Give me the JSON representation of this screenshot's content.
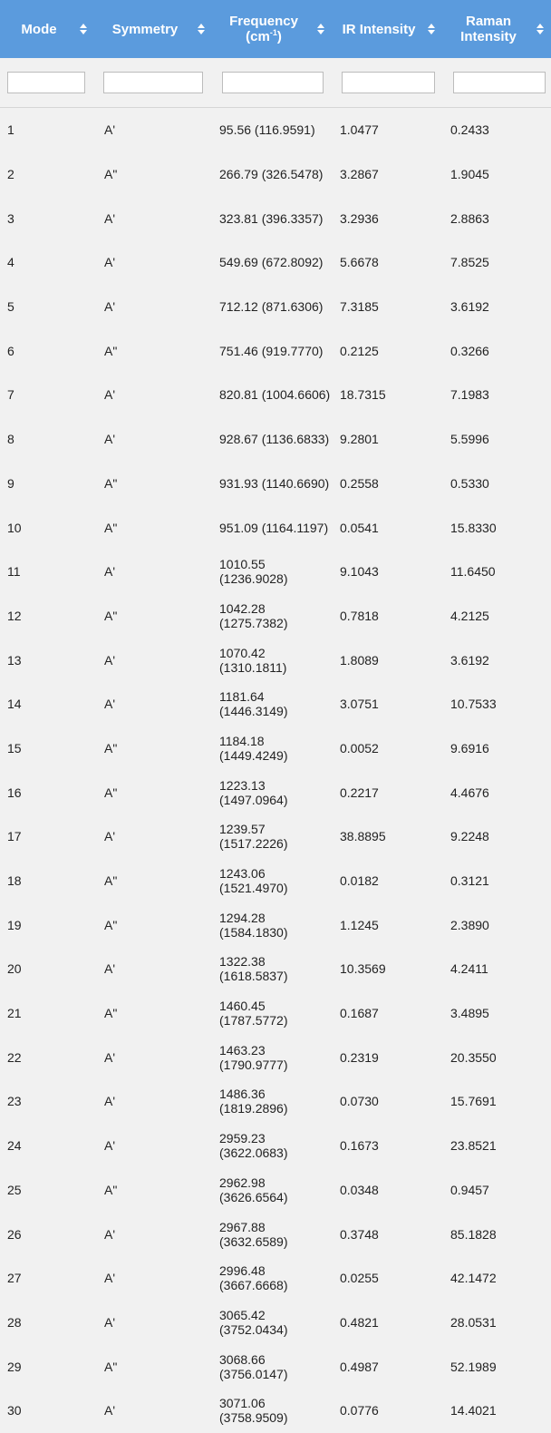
{
  "columns": [
    {
      "label": "Mode"
    },
    {
      "label": "Symmetry"
    },
    {
      "label": "Frequency (cm",
      "sup": "-1",
      "suffix": ")"
    },
    {
      "label": "IR Intensity"
    },
    {
      "label": "Raman Intensity"
    }
  ],
  "rows": [
    {
      "mode": "1",
      "sym": "A'",
      "freq": "95.56 (116.9591)",
      "ir": "1.0477",
      "raman": "0.2433"
    },
    {
      "mode": "2",
      "sym": "A\"",
      "freq": "266.79 (326.5478)",
      "ir": "3.2867",
      "raman": "1.9045"
    },
    {
      "mode": "3",
      "sym": "A'",
      "freq": "323.81 (396.3357)",
      "ir": "3.2936",
      "raman": "2.8863"
    },
    {
      "mode": "4",
      "sym": "A'",
      "freq": "549.69 (672.8092)",
      "ir": "5.6678",
      "raman": "7.8525"
    },
    {
      "mode": "5",
      "sym": "A'",
      "freq": "712.12 (871.6306)",
      "ir": "7.3185",
      "raman": "3.6192"
    },
    {
      "mode": "6",
      "sym": "A\"",
      "freq": "751.46 (919.7770)",
      "ir": "0.2125",
      "raman": "0.3266"
    },
    {
      "mode": "7",
      "sym": "A'",
      "freq": "820.81 (1004.6606)",
      "ir": "18.7315",
      "raman": "7.1983"
    },
    {
      "mode": "8",
      "sym": "A'",
      "freq": "928.67 (1136.6833)",
      "ir": "9.2801",
      "raman": "5.5996"
    },
    {
      "mode": "9",
      "sym": "A\"",
      "freq": "931.93 (1140.6690)",
      "ir": "0.2558",
      "raman": "0.5330"
    },
    {
      "mode": "10",
      "sym": "A\"",
      "freq": "951.09 (1164.1197)",
      "ir": "0.0541",
      "raman": "15.8330"
    },
    {
      "mode": "11",
      "sym": "A'",
      "freq": "1010.55 (1236.9028)",
      "ir": "9.1043",
      "raman": "11.6450"
    },
    {
      "mode": "12",
      "sym": "A\"",
      "freq": "1042.28 (1275.7382)",
      "ir": "0.7818",
      "raman": "4.2125"
    },
    {
      "mode": "13",
      "sym": "A'",
      "freq": "1070.42 (1310.1811)",
      "ir": "1.8089",
      "raman": "3.6192"
    },
    {
      "mode": "14",
      "sym": "A'",
      "freq": "1181.64 (1446.3149)",
      "ir": "3.0751",
      "raman": "10.7533"
    },
    {
      "mode": "15",
      "sym": "A\"",
      "freq": "1184.18 (1449.4249)",
      "ir": "0.0052",
      "raman": "9.6916"
    },
    {
      "mode": "16",
      "sym": "A\"",
      "freq": "1223.13 (1497.0964)",
      "ir": "0.2217",
      "raman": "4.4676"
    },
    {
      "mode": "17",
      "sym": "A'",
      "freq": "1239.57 (1517.2226)",
      "ir": "38.8895",
      "raman": "9.2248"
    },
    {
      "mode": "18",
      "sym": "A\"",
      "freq": "1243.06 (1521.4970)",
      "ir": "0.0182",
      "raman": "0.3121"
    },
    {
      "mode": "19",
      "sym": "A\"",
      "freq": "1294.28 (1584.1830)",
      "ir": "1.1245",
      "raman": "2.3890"
    },
    {
      "mode": "20",
      "sym": "A'",
      "freq": "1322.38 (1618.5837)",
      "ir": "10.3569",
      "raman": "4.2411"
    },
    {
      "mode": "21",
      "sym": "A\"",
      "freq": "1460.45 (1787.5772)",
      "ir": "0.1687",
      "raman": "3.4895"
    },
    {
      "mode": "22",
      "sym": "A'",
      "freq": "1463.23 (1790.9777)",
      "ir": "0.2319",
      "raman": "20.3550"
    },
    {
      "mode": "23",
      "sym": "A'",
      "freq": "1486.36 (1819.2896)",
      "ir": "0.0730",
      "raman": "15.7691"
    },
    {
      "mode": "24",
      "sym": "A'",
      "freq": "2959.23 (3622.0683)",
      "ir": "0.1673",
      "raman": "23.8521"
    },
    {
      "mode": "25",
      "sym": "A\"",
      "freq": "2962.98 (3626.6564)",
      "ir": "0.0348",
      "raman": "0.9457"
    },
    {
      "mode": "26",
      "sym": "A'",
      "freq": "2967.88 (3632.6589)",
      "ir": "0.3748",
      "raman": "85.1828"
    },
    {
      "mode": "27",
      "sym": "A'",
      "freq": "2996.48 (3667.6668)",
      "ir": "0.0255",
      "raman": "42.1472"
    },
    {
      "mode": "28",
      "sym": "A'",
      "freq": "3065.42 (3752.0434)",
      "ir": "0.4821",
      "raman": "28.0531"
    },
    {
      "mode": "29",
      "sym": "A\"",
      "freq": "3068.66 (3756.0147)",
      "ir": "0.4987",
      "raman": "52.1989"
    },
    {
      "mode": "30",
      "sym": "A'",
      "freq": "3071.06 (3758.9509)",
      "ir": "0.0776",
      "raman": "14.4021"
    }
  ],
  "filters": [
    "",
    "",
    "",
    "",
    ""
  ],
  "colors": {
    "header": "#5b9bdd",
    "body": "#f1f1f1"
  }
}
